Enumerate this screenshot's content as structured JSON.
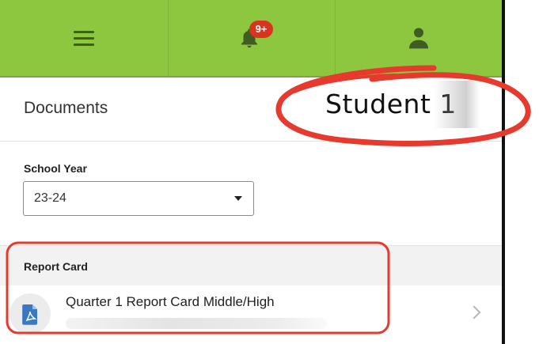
{
  "navbar": {
    "menu_icon": "hamburger-menu-icon",
    "notifications_icon": "bell-icon",
    "notifications_badge": "9+",
    "profile_icon": "person-icon",
    "bar_color": "#8dc63f",
    "badge_color": "#d9341e"
  },
  "header": {
    "title": "Documents",
    "student_label": "Student 1"
  },
  "school_year": {
    "label": "School Year",
    "selected": "23-24"
  },
  "report_card": {
    "section_title": "Report Card",
    "documents": [
      {
        "title": "Quarter 1 Report Card Middle/High",
        "icon": "pdf-file-icon"
      }
    ]
  },
  "annotations": {
    "highlight_color": "#e63a2e"
  }
}
